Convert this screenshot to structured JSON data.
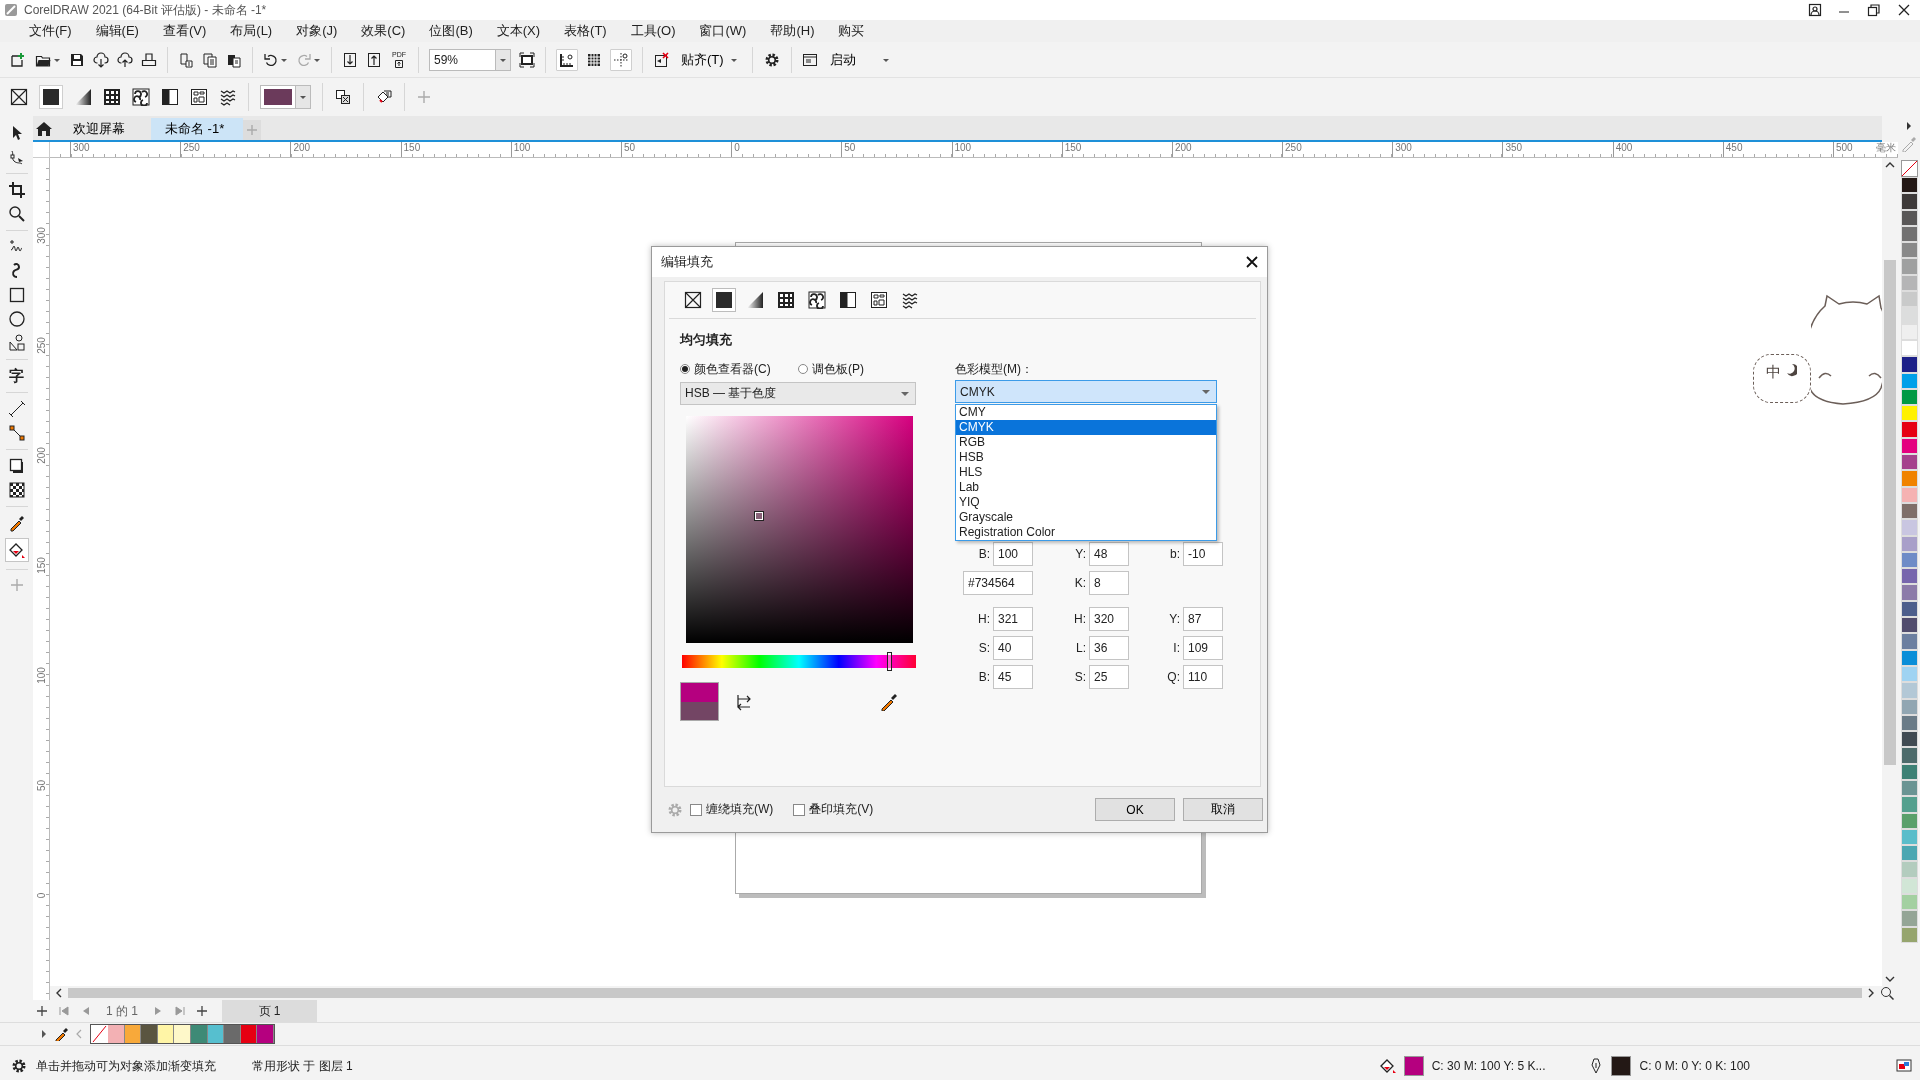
{
  "window": {
    "title": "CorelDRAW 2021 (64-Bit 评估版) - 未命名 -1*"
  },
  "menu": [
    "文件(F)",
    "编辑(E)",
    "查看(V)",
    "布局(L)",
    "对象(J)",
    "效果(C)",
    "位图(B)",
    "文本(X)",
    "表格(T)",
    "工具(O)",
    "窗口(W)",
    "帮助(H)",
    "购买"
  ],
  "toolbar": {
    "pdf_label": "PDF",
    "zoom": "59%",
    "snap": "贴齐(T)",
    "launch": "启动"
  },
  "property_bar": {
    "fill_swatch": {
      "color": "#6b3a5b"
    }
  },
  "doc_tabs": [
    {
      "label": "欢迎屏幕",
      "selected": false
    },
    {
      "label": "未命名 -1*",
      "selected": true
    }
  ],
  "toolbox": {
    "text_tool": "字"
  },
  "ruler": {
    "horizontal": [
      "300",
      "250",
      "200",
      "150",
      "100",
      "50",
      "0",
      "50",
      "100",
      "150",
      "200",
      "250",
      "300",
      "350",
      "400",
      "450",
      "500"
    ],
    "unit": "毫米",
    "vertical": [
      "300",
      "250",
      "200",
      "150",
      "100",
      "50",
      "0"
    ]
  },
  "dialog": {
    "title": "编辑填充",
    "fill_types": [
      {
        "kind": "none",
        "selected": false
      },
      {
        "kind": "uniform",
        "selected": true
      },
      {
        "kind": "fountain",
        "selected": false
      },
      {
        "kind": "vector",
        "selected": false
      },
      {
        "kind": "bitmap",
        "selected": false
      },
      {
        "kind": "two-color",
        "selected": false
      },
      {
        "kind": "texture",
        "selected": false
      },
      {
        "kind": "postscript",
        "selected": false
      }
    ],
    "heading": "均匀填充",
    "viewer_modes": [
      {
        "label": "颜色查看器(C)",
        "selected": true
      },
      {
        "label": "调色板(P)",
        "selected": false
      }
    ],
    "viewer": "HSB — 基于色度",
    "hue_slider": {
      "level": 0.89
    },
    "swatches": [
      {
        "color": "#b5007f"
      },
      {
        "color": "#734564"
      }
    ],
    "color_model_label": "色彩模型(M)：",
    "color_model": "CMYK",
    "color_model_options": [
      {
        "label": "CMY",
        "selected": false
      },
      {
        "label": "CMYK",
        "selected": true
      },
      {
        "label": "RGB",
        "selected": false
      },
      {
        "label": "HSB",
        "selected": false
      },
      {
        "label": "HLS",
        "selected": false
      },
      {
        "label": "Lab",
        "selected": false
      },
      {
        "label": "YIQ",
        "selected": false
      },
      {
        "label": "Grayscale",
        "selected": false
      },
      {
        "label": "Registration Color",
        "selected": false
      }
    ],
    "partial_fields": [
      {
        "label": "B:",
        "value": "100"
      },
      {
        "label": "Y:",
        "value": "48"
      },
      {
        "label": "b:",
        "value": "-10"
      }
    ],
    "hex": "#734564",
    "k_field": {
      "label": "K:",
      "value": "8"
    },
    "field_rows": [
      [
        {
          "label": "H:",
          "value": "321"
        },
        {
          "label": "H:",
          "value": "320"
        },
        {
          "label": "Y:",
          "value": "87"
        }
      ],
      [
        {
          "label": "S:",
          "value": "40"
        },
        {
          "label": "L:",
          "value": "36"
        },
        {
          "label": "I:",
          "value": "109"
        }
      ],
      [
        {
          "label": "B:",
          "value": "45"
        },
        {
          "label": "S:",
          "value": "25"
        },
        {
          "label": "Q:",
          "value": "110"
        }
      ]
    ],
    "options": [
      {
        "label": "缠绕填充(W)",
        "checked": false
      },
      {
        "label": "叠印填充(V)",
        "checked": false
      }
    ],
    "buttons": [
      "OK",
      "取消"
    ]
  },
  "ime": {
    "label": "中"
  },
  "page_nav": {
    "position": "1 的 1",
    "page_tab": "页 1"
  },
  "document_palette": [
    {
      "kind": "none"
    },
    {
      "kind": "color",
      "color": "#f3b1b4"
    },
    {
      "kind": "color",
      "color": "#f8a93a"
    },
    {
      "kind": "color",
      "color": "#5a5540"
    },
    {
      "kind": "color",
      "color": "#fff5a6"
    },
    {
      "kind": "color",
      "color": "#fef8c9"
    },
    {
      "kind": "color",
      "color": "#3e8a76"
    },
    {
      "kind": "color",
      "color": "#56bfcf"
    },
    {
      "kind": "color",
      "color": "#6a6a6a"
    },
    {
      "kind": "color",
      "color": "#e60012"
    },
    {
      "kind": "color",
      "color": "#b5007f"
    }
  ],
  "color_palette": [
    {
      "kind": "none"
    },
    {
      "kind": "color",
      "color": "#231815"
    },
    {
      "kind": "color",
      "color": "#3e3a39"
    },
    {
      "kind": "color",
      "color": "#595757"
    },
    {
      "kind": "color",
      "color": "#727171"
    },
    {
      "kind": "color",
      "color": "#898989"
    },
    {
      "kind": "color",
      "color": "#9fa0a0"
    },
    {
      "kind": "color",
      "color": "#b5b5b6"
    },
    {
      "kind": "color",
      "color": "#c9caca"
    },
    {
      "kind": "color",
      "color": "#dcdddd"
    },
    {
      "kind": "color",
      "color": "#efefef"
    },
    {
      "kind": "color",
      "color": "#ffffff"
    },
    {
      "kind": "color",
      "color": "#1d2088"
    },
    {
      "kind": "color",
      "color": "#00a0e9"
    },
    {
      "kind": "color",
      "color": "#009944"
    },
    {
      "kind": "color",
      "color": "#fff100"
    },
    {
      "kind": "color",
      "color": "#e60012"
    },
    {
      "kind": "color",
      "color": "#e4007f"
    },
    {
      "kind": "color",
      "color": "#a5418c"
    },
    {
      "kind": "color",
      "color": "#f08300"
    },
    {
      "kind": "color",
      "color": "#f5b2b2"
    },
    {
      "kind": "color",
      "color": "#7f6f69"
    },
    {
      "kind": "color",
      "color": "#c9c6e1"
    },
    {
      "kind": "color",
      "color": "#a89fc9"
    },
    {
      "kind": "color",
      "color": "#6f8cc7"
    },
    {
      "kind": "color",
      "color": "#7766ad"
    },
    {
      "kind": "color",
      "color": "#8c7ba9"
    },
    {
      "kind": "color",
      "color": "#4d5e8c"
    },
    {
      "kind": "color",
      "color": "#514c6d"
    },
    {
      "kind": "color",
      "color": "#6c7fa0"
    },
    {
      "kind": "color",
      "color": "#0a8ed8"
    },
    {
      "kind": "color",
      "color": "#9fd3f2"
    },
    {
      "kind": "color",
      "color": "#b3c8d6"
    },
    {
      "kind": "color",
      "color": "#91a6b2"
    },
    {
      "kind": "color",
      "color": "#6a7b87"
    },
    {
      "kind": "color",
      "color": "#414b53"
    },
    {
      "kind": "color",
      "color": "#4d6b6b"
    },
    {
      "kind": "color",
      "color": "#3d8175"
    },
    {
      "kind": "color",
      "color": "#6a9493"
    },
    {
      "kind": "color",
      "color": "#54a08e"
    },
    {
      "kind": "color",
      "color": "#5aa06b"
    },
    {
      "kind": "color",
      "color": "#5abdca"
    },
    {
      "kind": "color",
      "color": "#4ba7b2"
    },
    {
      "kind": "color",
      "color": "#b3ccbe"
    },
    {
      "kind": "color",
      "color": "#d1e6d6"
    },
    {
      "kind": "color",
      "color": "#a3d0a1"
    },
    {
      "kind": "color",
      "color": "#94a596"
    },
    {
      "kind": "color",
      "color": "#96a56e"
    }
  ],
  "status_bar": {
    "hint": "单击并拖动可为对象添加渐变填充",
    "layer": "常用形状 于 图层 1",
    "fill": {
      "color": "#b5007f",
      "values": "C:  30 M:  100 Y:  5 K..."
    },
    "outline": {
      "color": "#231815",
      "values": "C:  0 M:  0 Y:  0 K:  100"
    }
  }
}
